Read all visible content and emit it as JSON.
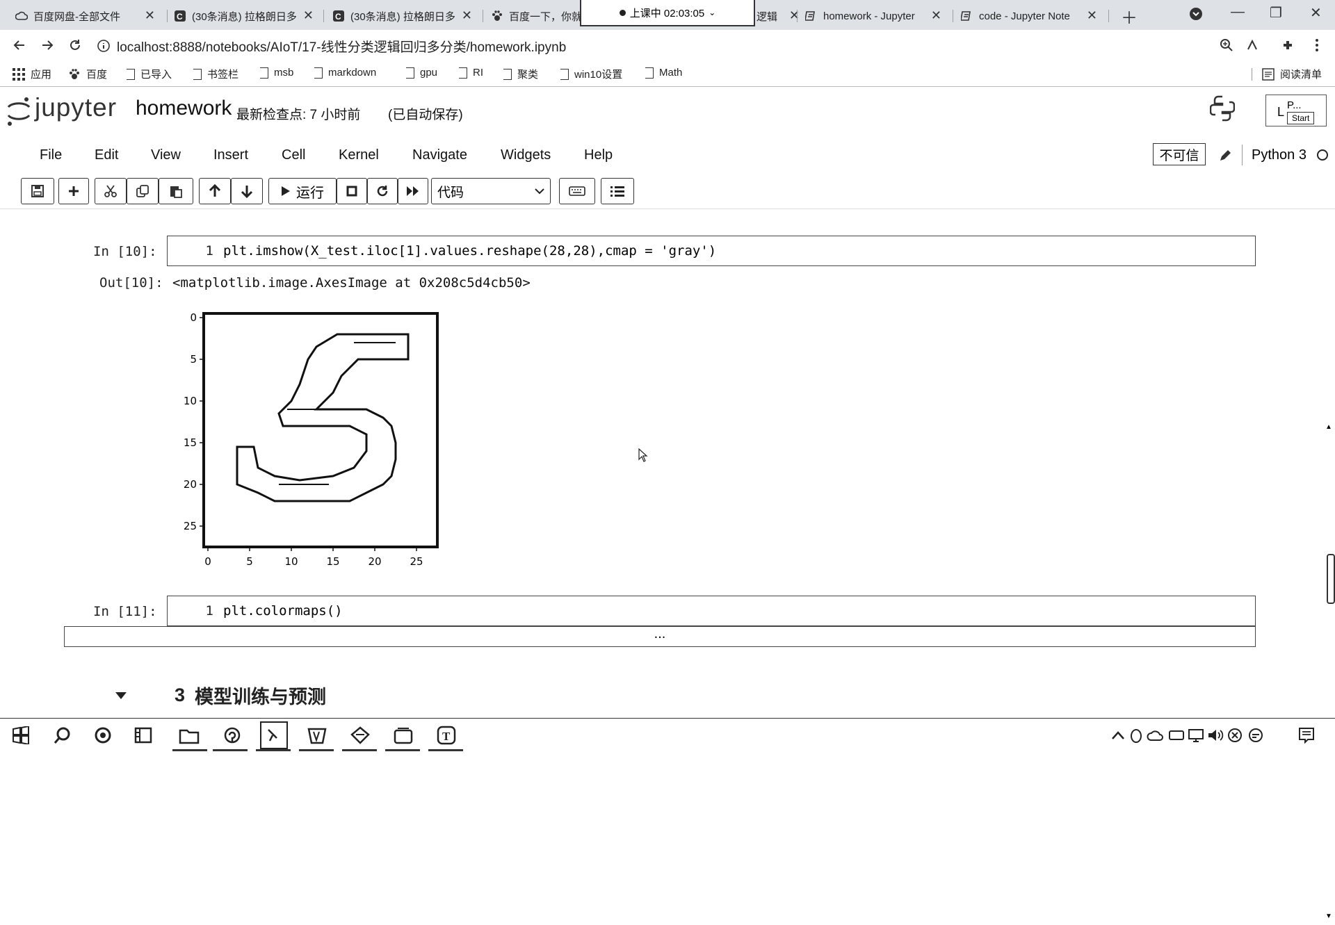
{
  "browser": {
    "tabs": [
      {
        "title": "百度网盘-全部文件",
        "icon": "cloud-icon"
      },
      {
        "title": "(30条消息) 拉格朗日多",
        "icon": "csdn-icon"
      },
      {
        "title": "(30条消息) 拉格朗日多",
        "icon": "csdn-icon"
      },
      {
        "title": "百度一下，你就",
        "icon": "baidu-paw-icon"
      },
      {
        "title": "逻辑",
        "icon": "jupyter-icon"
      },
      {
        "title": "homework - Jupyter",
        "icon": "jupyter-icon"
      },
      {
        "title": "code - Jupyter Note",
        "icon": "jupyter-icon"
      }
    ],
    "meeting_status": "上课中 02:03:05",
    "url": "localhost:8888/notebooks/AIoT/17-线性分类逻辑回归多分类/homework.ipynb",
    "bookmarks": [
      "应用",
      "百度",
      "已导入",
      "书签栏",
      "msb",
      "markdown",
      "gpu",
      "RI",
      "聚类",
      "win10设置",
      "Math"
    ],
    "reading_list": "阅读清单"
  },
  "jupyter": {
    "logo_text": "jupyter",
    "notebook_name": "homework",
    "checkpoint": "最新检查点: 7 小时前",
    "autosave": "(已自动保存)",
    "login_label": "L",
    "login_popup": "P...",
    "login_start": "Start",
    "menu": [
      "File",
      "Edit",
      "View",
      "Insert",
      "Cell",
      "Kernel",
      "Navigate",
      "Widgets",
      "Help"
    ],
    "trust_label": "不可信",
    "kernel_name": "Python 3",
    "toolbar": {
      "run_label": "运行",
      "cell_type": "代码"
    }
  },
  "cells": [
    {
      "prompt_in": "In  [10]:",
      "line_no": "1",
      "code": "plt.imshow(X_test.iloc[1].values.reshape(28,28),cmap = 'gray')",
      "prompt_out": "Out[10]:",
      "output_text": "<matplotlib.image.AxesImage at 0x208c5d4cb50>"
    },
    {
      "prompt_in": "In  [11]:",
      "line_no": "1",
      "code": "plt.colormaps()",
      "collapsed_output": "..."
    }
  ],
  "section_heading": {
    "number": "3",
    "title": "模型训练与预测"
  },
  "plot": {
    "type": "image",
    "x_ticks": [
      "0",
      "5",
      "10",
      "15",
      "20",
      "25"
    ],
    "y_ticks": [
      "0",
      "5",
      "10",
      "15",
      "20",
      "25"
    ],
    "x_range": [
      -0.5,
      27.5
    ],
    "y_range": [
      -0.5,
      27.5
    ],
    "cmap": "gray"
  },
  "colors": {
    "tab_strip": "#dee1e6",
    "cell_border": "#444444",
    "text": "#111111"
  }
}
